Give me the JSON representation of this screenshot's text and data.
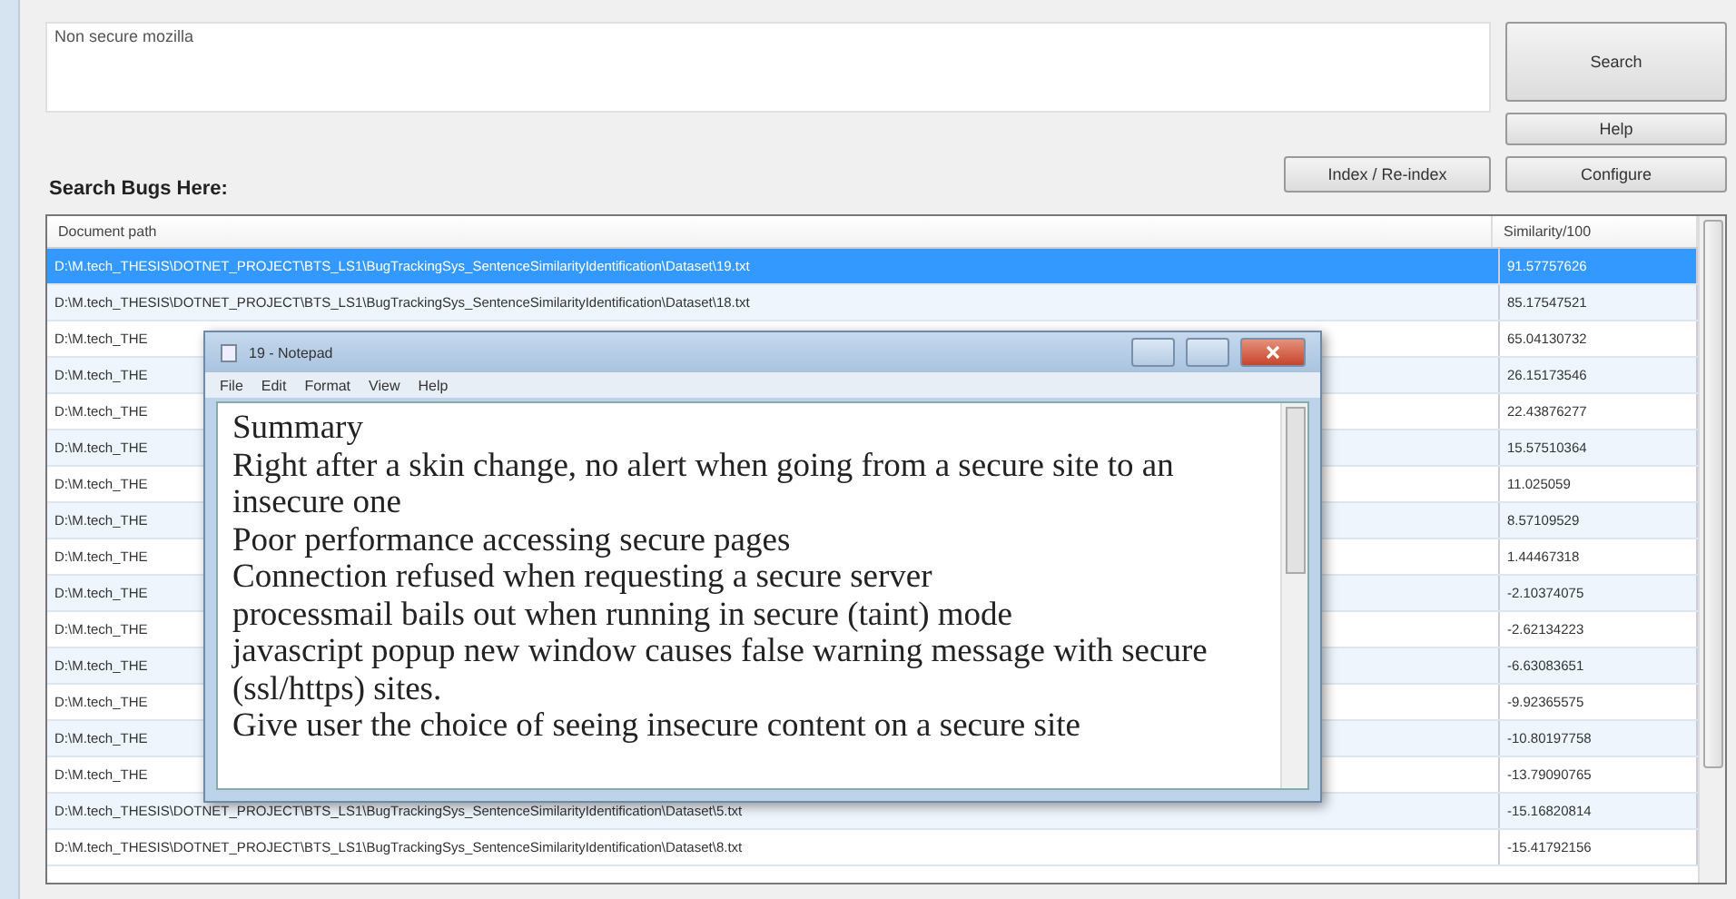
{
  "query": {
    "value": "Non secure mozilla"
  },
  "buttons": {
    "search": "Search",
    "help": "Help",
    "index": "Index / Re-index",
    "configure": "Configure"
  },
  "label": "Search Bugs Here:",
  "table": {
    "columns": [
      "Document path",
      "Similarity/100"
    ],
    "rows": [
      {
        "path": "D:\\M.tech_THESIS\\DOTNET_PROJECT\\BTS_LS1\\BugTrackingSys_SentenceSimilarityIdentification\\Dataset\\19.txt",
        "score": "91.57757626",
        "selected": true
      },
      {
        "path": "D:\\M.tech_THESIS\\DOTNET_PROJECT\\BTS_LS1\\BugTrackingSys_SentenceSimilarityIdentification\\Dataset\\18.txt",
        "score": "85.17547521",
        "selected": false
      },
      {
        "path": "D:\\M.tech_THE",
        "score": "65.04130732",
        "selected": false
      },
      {
        "path": "D:\\M.tech_THE",
        "score": "26.15173546",
        "selected": false
      },
      {
        "path": "D:\\M.tech_THE",
        "score": "22.43876277",
        "selected": false
      },
      {
        "path": "D:\\M.tech_THE",
        "score": "15.57510364",
        "selected": false
      },
      {
        "path": "D:\\M.tech_THE",
        "score": "11.025059",
        "selected": false
      },
      {
        "path": "D:\\M.tech_THE",
        "score": "8.57109529",
        "selected": false
      },
      {
        "path": "D:\\M.tech_THE",
        "score": "1.44467318",
        "selected": false
      },
      {
        "path": "D:\\M.tech_THE",
        "score": "-2.10374075",
        "selected": false
      },
      {
        "path": "D:\\M.tech_THE",
        "score": "-2.62134223",
        "selected": false
      },
      {
        "path": "D:\\M.tech_THE",
        "score": "-6.63083651",
        "selected": false
      },
      {
        "path": "D:\\M.tech_THE",
        "score": "-9.92365575",
        "selected": false
      },
      {
        "path": "D:\\M.tech_THE",
        "score": "-10.80197758",
        "selected": false
      },
      {
        "path": "D:\\M.tech_THE",
        "score": "-13.79090765",
        "selected": false
      },
      {
        "path": "D:\\M.tech_THESIS\\DOTNET_PROJECT\\BTS_LS1\\BugTrackingSys_SentenceSimilarityIdentification\\Dataset\\5.txt",
        "score": "-15.16820814",
        "selected": false
      },
      {
        "path": "D:\\M.tech_THESIS\\DOTNET_PROJECT\\BTS_LS1\\BugTrackingSys_SentenceSimilarityIdentification\\Dataset\\8.txt",
        "score": "-15.41792156",
        "selected": false
      }
    ]
  },
  "notepad": {
    "title": "19 - Notepad",
    "menu": [
      "File",
      "Edit",
      "Format",
      "View",
      "Help"
    ],
    "lines": [
      "Summary",
      "Right after a skin change, no alert when going from a secure site to an insecure one",
      "Poor performance accessing secure pages",
      "Connection refused when requesting a secure server",
      "processmail bails out when running in secure (taint) mode",
      "javascript popup new window causes false warning message with secure (ssl/https) sites.",
      "Give user the choice of seeing insecure content on a secure site"
    ]
  }
}
